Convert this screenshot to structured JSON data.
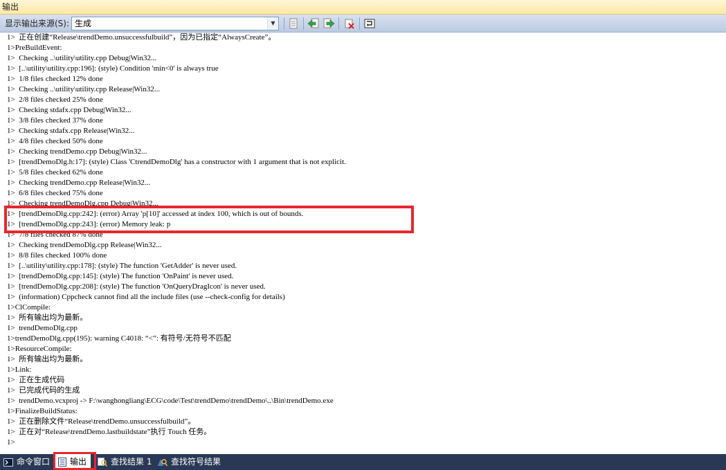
{
  "window": {
    "title": "输出"
  },
  "toolbar": {
    "source_label": "显示输出来源(S):",
    "source_value": "生成",
    "buttons": [
      "go-to-location-icon",
      "previous-message-icon",
      "next-message-icon",
      "clear-all-icon",
      "toggle-word-wrap-icon"
    ]
  },
  "output": {
    "lines": [
      "1>  正在创建“Release\\trendDemo.unsuccessfulbuild”，因为已指定“AlwaysCreate”。",
      "1>PreBuildEvent:",
      "1>  Checking ..\\utility\\utility.cpp Debug|Win32...",
      "1>  [..\\utility\\utility.cpp:196]: (style) Condition 'min<0' is always true",
      "1>  1/8 files checked 12% done",
      "1>  Checking ..\\utility\\utility.cpp Release|Win32...",
      "1>  2/8 files checked 25% done",
      "1>  Checking stdafx.cpp Debug|Win32...",
      "1>  3/8 files checked 37% done",
      "1>  Checking stdafx.cpp Release|Win32...",
      "1>  4/8 files checked 50% done",
      "1>  Checking trendDemo.cpp Debug|Win32...",
      "1>  [trendDemoDlg.h:17]: (style) Class 'CtrendDemoDlg' has a constructor with 1 argument that is not explicit.",
      "1>  5/8 files checked 62% done",
      "1>  Checking trendDemo.cpp Release|Win32...",
      "1>  6/8 files checked 75% done",
      "1>  Checking trendDemoDlg.cpp Debug|Win32...",
      "1>  [trendDemoDlg.cpp:242]: (error) Array 'p[10]' accessed at index 100, which is out of bounds.",
      "1>  [trendDemoDlg.cpp:243]: (error) Memory leak: p",
      "1>  7/8 files checked 87% done",
      "1>  Checking trendDemoDlg.cpp Release|Win32...",
      "1>  8/8 files checked 100% done",
      "1>  [..\\utility\\utility.cpp:178]: (style) The function 'GetAdder' is never used.",
      "1>  [trendDemoDlg.cpp:145]: (style) The function 'OnPaint' is never used.",
      "1>  [trendDemoDlg.cpp:208]: (style) The function 'OnQueryDragIcon' is never used.",
      "1>  (information) Cppcheck cannot find all the include files (use --check-config for details)",
      "1>ClCompile:",
      "1>  所有输出均为最新。",
      "1>  trendDemoDlg.cpp",
      "1>trendDemoDlg.cpp(195): warning C4018: “<”: 有符号/无符号不匹配",
      "1>ResourceCompile:",
      "1>  所有输出均为最新。",
      "1>Link:",
      "1>  正在生成代码",
      "1>  已完成代码的生成",
      "1>  trendDemo.vcxproj -> F:\\wanghongliang\\ECG\\code\\Test\\trendDemo\\trendDemo\\..\\Bin\\trendDemo.exe",
      "1>FinalizeBuildStatus:",
      "1>  正在删除文件“Release\\trendDemo.unsuccessfulbuild”。",
      "1>  正在对“Release\\trendDemo.lastbuildstate”执行 Touch 任务。",
      "1>"
    ]
  },
  "tabs": [
    {
      "label": "命令窗口",
      "icon": "command-window-icon"
    },
    {
      "label": "输出",
      "icon": "output-icon",
      "active": true
    },
    {
      "label": "查找结果 1",
      "icon": "find-results-icon"
    },
    {
      "label": "查找符号结果",
      "icon": "find-symbol-icon"
    }
  ],
  "colors": {
    "accent_highlight": "#e8262d",
    "tab_bar": "#293955"
  }
}
